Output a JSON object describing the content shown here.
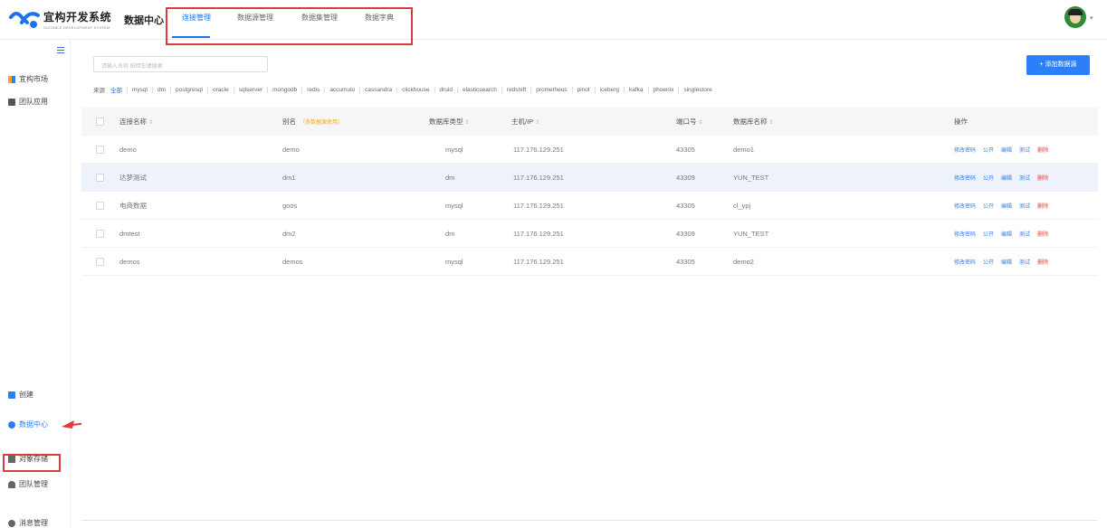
{
  "header": {
    "logo_title": "宜构开发系统",
    "logo_subtitle": "SUITABLE DEVELOPMENT SYSTEM",
    "app_title": "数据中心",
    "tabs": [
      {
        "label": "连接管理",
        "active": true
      },
      {
        "label": "数据源管理",
        "active": false
      },
      {
        "label": "数据集管理",
        "active": false
      },
      {
        "label": "数据字典",
        "active": false
      }
    ]
  },
  "sidebar": {
    "top_items": [
      {
        "label": "宜构市场",
        "icon": "market-icon"
      },
      {
        "label": "团队应用",
        "icon": "team-app-icon"
      }
    ],
    "bottom_items": [
      {
        "label": "创建",
        "icon": "create-icon"
      },
      {
        "label": "数据中心",
        "icon": "database-icon",
        "active": true
      },
      {
        "label": "对象存储",
        "icon": "storage-icon"
      },
      {
        "label": "团队管理",
        "icon": "team-manage-icon"
      },
      {
        "label": "消息管理",
        "icon": "message-icon"
      }
    ]
  },
  "toolbar": {
    "search_placeholder": "请输入名称 按回车键搜索",
    "add_button": "+ 添加数据源"
  },
  "sources": {
    "label": "来源",
    "items": [
      "全部",
      "mysql",
      "dm",
      "postgresql",
      "oracle",
      "sqlserver",
      "mongodb",
      "redis",
      "accumulo",
      "cassandra",
      "clickhouse",
      "druid",
      "elasticsearch",
      "redshift",
      "prometheus",
      "pinot",
      "iceberg",
      "kafka",
      "phoenix",
      "singlestore"
    ]
  },
  "table": {
    "columns": {
      "name": "连接名称",
      "alias": "别名",
      "alias_tip": "（多数据源使用）",
      "db_type": "数据库类型",
      "host": "主机/IP",
      "port": "端口号",
      "db_name": "数据库名称",
      "ops": "操作"
    },
    "sort_glyph": "⇕",
    "rows": [
      {
        "name": "demo",
        "alias": "demo",
        "db_type": "mysql",
        "host": "117.176.129.251",
        "port": "43305",
        "db_name": "demo1",
        "highlight": false
      },
      {
        "name": "达梦测试",
        "alias": "dm1",
        "db_type": "dm",
        "host": "117.176.129.251",
        "port": "43309",
        "db_name": "YUN_TEST",
        "highlight": true
      },
      {
        "name": "电商数据",
        "alias": "goos",
        "db_type": "mysql",
        "host": "117.176.129.251",
        "port": "43305",
        "db_name": "cl_ypj",
        "highlight": false
      },
      {
        "name": "dmtest",
        "alias": "dm2",
        "db_type": "dm",
        "host": "117.176.129.251",
        "port": "43309",
        "db_name": "YUN_TEST",
        "highlight": false
      },
      {
        "name": "demos",
        "alias": "demos",
        "db_type": "mysql",
        "host": "117.176.129.251",
        "port": "43305",
        "db_name": "demo2",
        "highlight": false
      }
    ],
    "ops": [
      "修改密码",
      "公开",
      "编辑",
      "测试",
      "删除"
    ]
  },
  "colors": {
    "accent": "#2d7ff9",
    "danger": "#e0393e",
    "warning": "#f5a623"
  }
}
